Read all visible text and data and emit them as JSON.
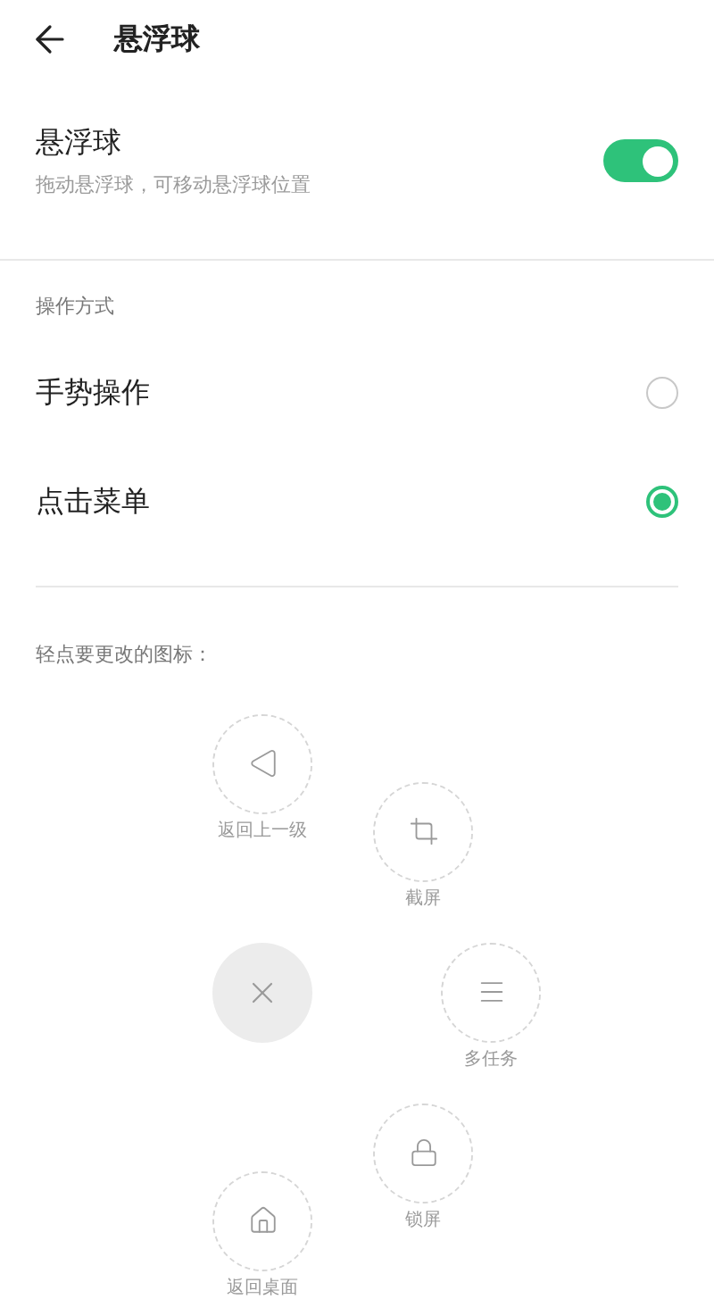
{
  "header": {
    "title": "悬浮球"
  },
  "floating_ball": {
    "title": "悬浮球",
    "subtitle": "拖动悬浮球，可移动悬浮球位置",
    "on": true
  },
  "mode_section": {
    "label": "操作方式",
    "options": [
      {
        "label": "手势操作",
        "selected": false
      },
      {
        "label": "点击菜单",
        "selected": true
      }
    ]
  },
  "icons_section": {
    "hint": "轻点要更改的图标：",
    "items": [
      {
        "kind": "back",
        "label": "返回上一级"
      },
      {
        "kind": "crop",
        "label": "截屏"
      },
      {
        "kind": "close"
      },
      {
        "kind": "menu",
        "label": "多任务"
      },
      {
        "kind": "lock",
        "label": "锁屏"
      },
      {
        "kind": "home",
        "label": "返回桌面"
      }
    ]
  }
}
